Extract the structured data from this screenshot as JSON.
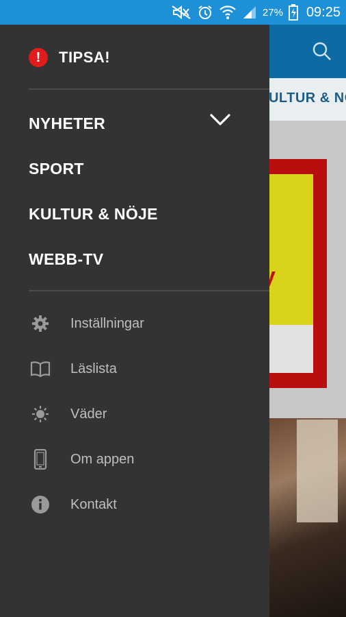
{
  "status_bar": {
    "battery_percent": "27%",
    "time": "09:25",
    "background_color": "#1e90d8",
    "icons": [
      "mute-icon",
      "alarm-icon",
      "wifi-icon",
      "signal-icon",
      "battery-charging-icon"
    ]
  },
  "background_app": {
    "tab_label": "KULTUR & NÖJE",
    "ad_letter": "y"
  },
  "drawer": {
    "tipsa_label": "TIPSA!",
    "sections": [
      {
        "label": "NYHETER"
      },
      {
        "label": "SPORT"
      },
      {
        "label": "KULTUR & NÖJE"
      },
      {
        "label": "WEBB-TV"
      }
    ],
    "menu": [
      {
        "label": "Inställningar",
        "icon": "gear-icon"
      },
      {
        "label": "Läslista",
        "icon": "book-icon"
      },
      {
        "label": "Väder",
        "icon": "sun-icon"
      },
      {
        "label": "Om appen",
        "icon": "phone-icon"
      },
      {
        "label": "Kontakt",
        "icon": "info-icon"
      }
    ]
  },
  "colors": {
    "drawer": "#333333",
    "accent_red": "#e21c1c",
    "app_bar": "#0e6aa3"
  }
}
